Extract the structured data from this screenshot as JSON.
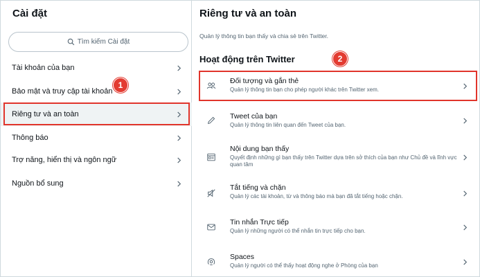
{
  "sidebar": {
    "title": "Cài đặt",
    "search_placeholder": "Tìm kiếm Cài đặt",
    "items": [
      {
        "label": "Tài khoản của bạn"
      },
      {
        "label": "Bảo mật và truy cập tài khoản"
      },
      {
        "label": "Riêng tư và an toàn",
        "active": true
      },
      {
        "label": "Thông báo"
      },
      {
        "label": "Trợ năng, hiển thị và ngôn ngữ"
      },
      {
        "label": "Nguồn bổ sung"
      }
    ]
  },
  "main": {
    "title": "Riêng tư và an toàn",
    "subtitle": "Quản lý thông tin bạn thấy và chia sẻ trên Twitter.",
    "section_heading": "Hoạt động trên Twitter",
    "items": [
      {
        "title": "Đối tượng và gắn thẻ",
        "desc": "Quản lý thông tin bạn cho phép người khác trên Twitter xem.",
        "icon": "people-icon"
      },
      {
        "title": "Tweet của bạn",
        "desc": "Quản lý thông tin liên quan đến Tweet của bạn.",
        "icon": "pencil-icon"
      },
      {
        "title": "Nội dung bạn thấy",
        "desc": "Quyết định những gì bạn thấy trên Twitter dựa trên sở thích của bạn như Chủ đề và lĩnh vực quan tâm",
        "icon": "content-icon"
      },
      {
        "title": "Tắt tiếng và chặn",
        "desc": "Quản lý các tài khoản, từ và thông báo mà bạn đã tắt tiếng hoặc chặn.",
        "icon": "mute-icon"
      },
      {
        "title": "Tin nhắn Trực tiếp",
        "desc": "Quản lý những người có thể nhắn tin trực tiếp cho bạn.",
        "icon": "envelope-icon"
      },
      {
        "title": "Spaces",
        "desc": "Quản lý người có thể thấy hoạt động nghe ở Phòng của bạn",
        "icon": "spaces-icon"
      }
    ]
  },
  "annotations": {
    "badge_1": "1",
    "badge_2": "2"
  },
  "colors": {
    "highlight": "#e1342b",
    "active_bg": "#eff3f4",
    "muted_text": "#536471"
  }
}
